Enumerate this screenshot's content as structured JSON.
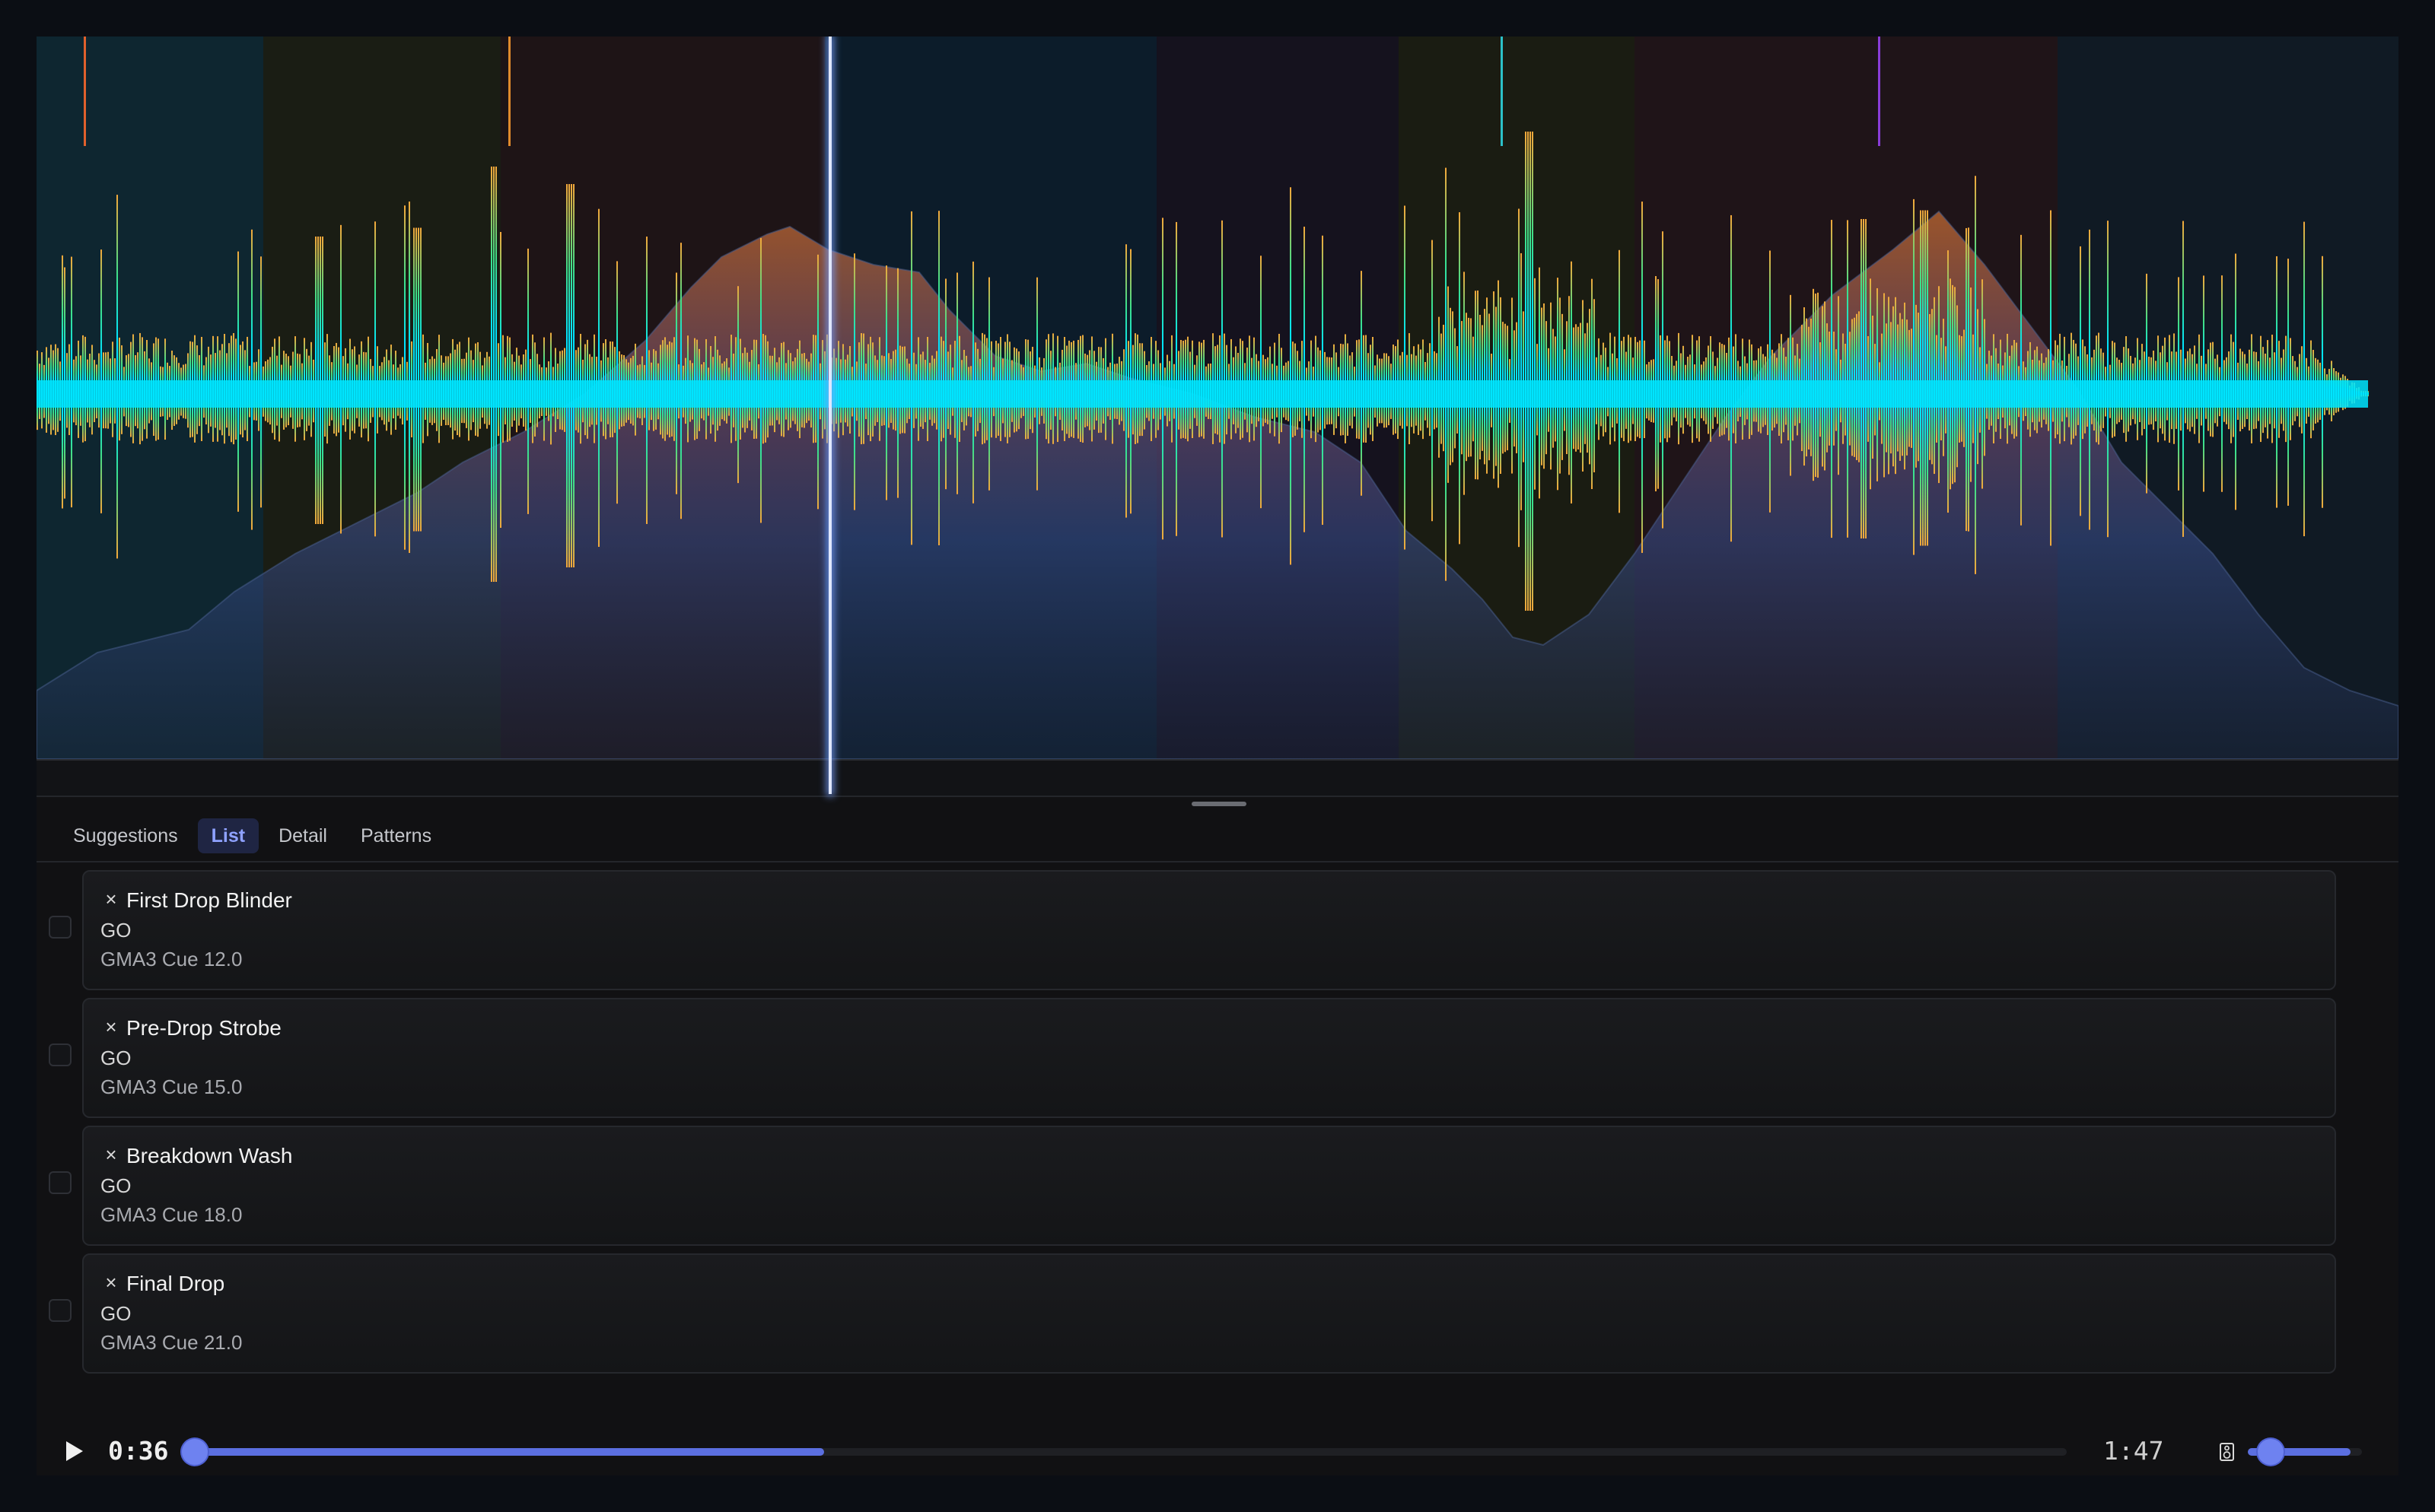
{
  "tabs": [
    {
      "label": "Suggestions",
      "active": false
    },
    {
      "label": "List",
      "active": true
    },
    {
      "label": "Detail",
      "active": false
    },
    {
      "label": "Patterns",
      "active": false
    }
  ],
  "cues": [
    {
      "name": "First Drop Blinder",
      "action": "GO",
      "target": "GMA3 Cue 12.0",
      "remove_icon": "×"
    },
    {
      "name": "Pre-Drop Strobe",
      "action": "GO",
      "target": "GMA3 Cue 15.0",
      "remove_icon": "×"
    },
    {
      "name": "Breakdown Wash",
      "action": "GO",
      "target": "GMA3 Cue 18.0",
      "remove_icon": "×"
    },
    {
      "name": "Final Drop",
      "action": "GO",
      "target": "GMA3 Cue 21.0",
      "remove_icon": "×"
    }
  ],
  "transport": {
    "current_time": "0:36",
    "total_time": "1:47",
    "progress": 0.336,
    "volume": 0.9
  },
  "waveform": {
    "colors": {
      "waveform_core": "#00e5ff",
      "waveform_high": "#3ee08a",
      "waveform_peak": "#f4a83a",
      "energy_fill": "#3a4f8f",
      "energy_hot": "#a0552e",
      "playhead": "#dfe7ff",
      "accent": "#5b6fe0"
    },
    "sections": [
      {
        "color": "#0e2630"
      },
      {
        "color": "#1a1d14"
      },
      {
        "color": "#1e1416"
      },
      {
        "color": "#0c1c2a"
      },
      {
        "color": "#15121e"
      },
      {
        "color": "#1a1c12"
      },
      {
        "color": "#1f1418"
      },
      {
        "color": "#101a24"
      }
    ],
    "markers": [
      {
        "color": "#e0602c"
      },
      {
        "color": "#e08a2c"
      },
      {
        "color": "#2cc0c8"
      },
      {
        "color": "#8a3cd8"
      }
    ]
  }
}
